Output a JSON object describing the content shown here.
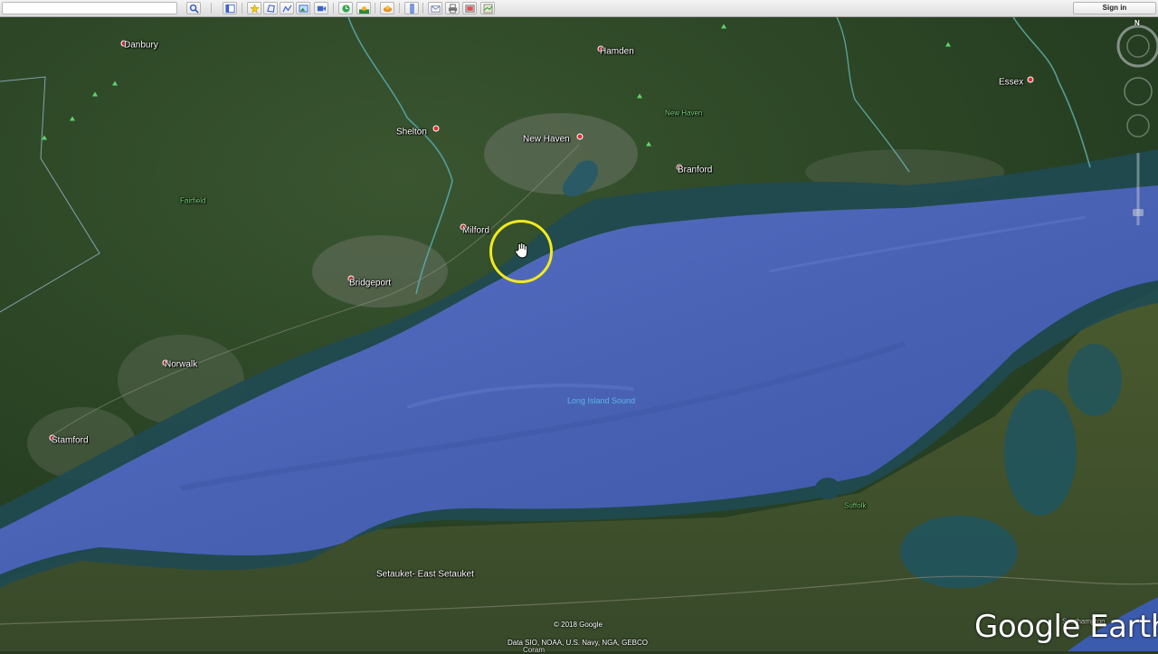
{
  "toolbar": {
    "search_placeholder": "",
    "signin_label": "Sign in",
    "buttons": [
      {
        "name": "search-icon"
      },
      {
        "name": "sidebar-toggle-icon"
      },
      {
        "name": "add-placemark-icon"
      },
      {
        "name": "add-polygon-icon"
      },
      {
        "name": "add-path-icon"
      },
      {
        "name": "add-image-overlay-icon"
      },
      {
        "name": "record-tour-icon"
      },
      {
        "name": "historical-imagery-icon"
      },
      {
        "name": "sunlight-icon"
      },
      {
        "name": "switch-to-sky-icon"
      },
      {
        "name": "ruler-icon"
      },
      {
        "name": "email-icon"
      },
      {
        "name": "print-icon"
      },
      {
        "name": "save-image-icon"
      },
      {
        "name": "view-in-maps-icon"
      }
    ]
  },
  "map": {
    "places": [
      {
        "name": "Danbury"
      },
      {
        "name": "Hamden"
      },
      {
        "name": "Essex"
      },
      {
        "name": "Shelton"
      },
      {
        "name": "New Haven"
      },
      {
        "name": "New Haven"
      },
      {
        "name": "Branford"
      },
      {
        "name": "Fairfield"
      },
      {
        "name": "Milford"
      },
      {
        "name": "Bridgeport"
      },
      {
        "name": "Norwalk"
      },
      {
        "name": "Stamford"
      },
      {
        "name": "Long Island Sound"
      },
      {
        "name": "Suffolk"
      },
      {
        "name": "Setauket- East Setauket"
      }
    ],
    "copyright": "© 2018 Google",
    "data_credits": "Data SIO, NOAA, U.S. Navy, NGA, GEBCO",
    "partial_label": "Coram",
    "partial_label_right": "Southampton"
  },
  "nav": {
    "north_label": "N"
  },
  "logo": "Google Earth",
  "colors": {
    "water": "#4a62b4",
    "land": "#2f4a26",
    "cursor_ring": "#f2ea1c"
  }
}
